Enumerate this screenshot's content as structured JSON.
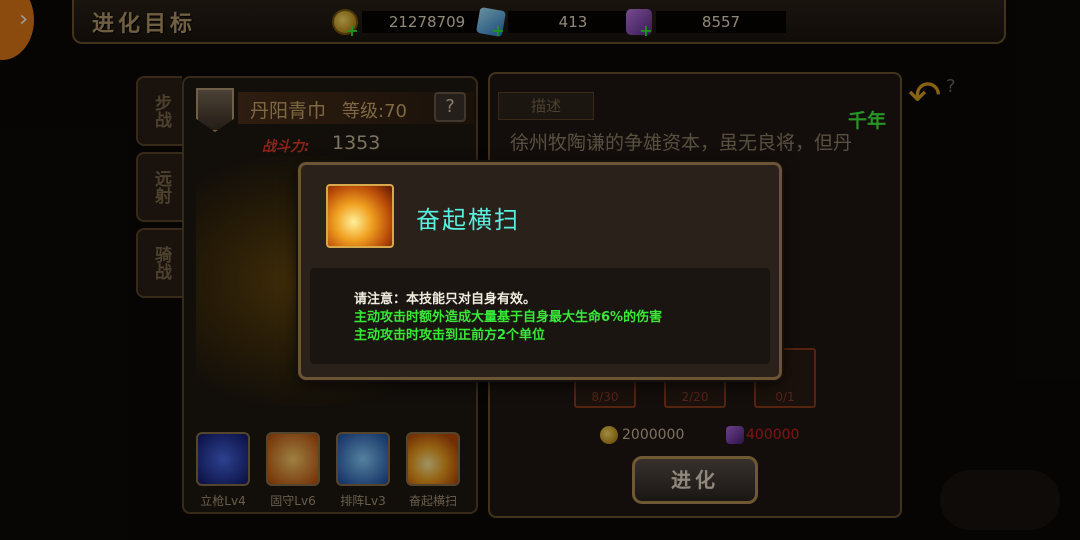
{
  "top_bar": {
    "title": "进化目标",
    "resources": [
      {
        "icon": "coin-icon",
        "value": "21278709"
      },
      {
        "icon": "blue-gem-icon",
        "value": "413"
      },
      {
        "icon": "purple-gem-icon",
        "value": "8557"
      }
    ]
  },
  "side_tabs": [
    "步战",
    "远射",
    "骑战"
  ],
  "hero": {
    "name": "丹阳青巾",
    "level_label": "等级:70",
    "help": "?",
    "power_label": "战斗力:",
    "power_value": "1353"
  },
  "skills": [
    {
      "label": "立枪Lv4",
      "icon": "spear-skill-icon",
      "color": "#1a2a8a"
    },
    {
      "label": "固守Lv6",
      "icon": "shield-skill-icon",
      "color": "#c05a10"
    },
    {
      "label": "排阵Lv3",
      "icon": "formation-skill-icon",
      "color": "#2a5aa8"
    },
    {
      "label": "奋起横扫",
      "icon": "sweep-skill-icon",
      "color": "#e08a18"
    }
  ],
  "detail": {
    "tab_label": "描述",
    "quality": "千年",
    "description": "徐州牧陶谦的争雄资本，虽无良将，但丹阳……好勇斗狠……兵。",
    "materials": [
      {
        "count": "8/30"
      },
      {
        "count": "2/20"
      },
      {
        "count": "0/1"
      }
    ],
    "cost_gold": "2000000",
    "cost_gem": "400000",
    "evolve_label": "进化"
  },
  "popup": {
    "skill_name": "奋起横扫",
    "note": "请注意：本技能只对自身有效。",
    "effects": [
      "主动攻击时额外造成大量基于自身最大生命6%的伤害",
      "主动攻击时攻击到正前方2个单位"
    ]
  }
}
